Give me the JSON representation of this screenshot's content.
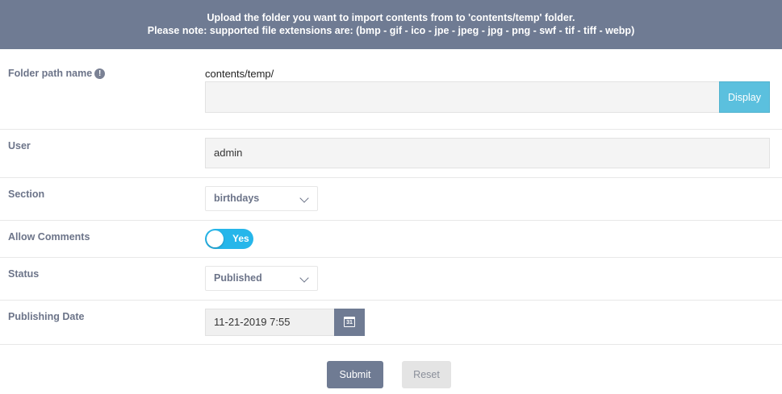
{
  "banner": {
    "line1": "Upload the folder you want to import contents from to 'contents/temp' folder.",
    "line2": "Please note: supported file extensions are: (bmp - gif - ico - jpe - jpeg - jpg - png - swf - tif - tiff - webp)"
  },
  "folder": {
    "label": "Folder path name",
    "info_icon": "!",
    "path": "contents/temp/",
    "input_value": "",
    "display_label": "Display"
  },
  "user": {
    "label": "User",
    "value": "admin"
  },
  "section": {
    "label": "Section",
    "selected": "birthdays"
  },
  "comments": {
    "label": "Allow Comments",
    "toggle_text": "Yes",
    "enabled": true
  },
  "status": {
    "label": "Status",
    "selected": "Published"
  },
  "publishing": {
    "label": "Publishing Date",
    "value": "11-21-2019 7:55",
    "calendar_icon_text": "31"
  },
  "actions": {
    "submit_label": "Submit",
    "reset_label": "Reset"
  },
  "colors": {
    "banner": "#6f7b93",
    "display_button": "#5bc0de",
    "toggle_on": "#26b6ea",
    "label_text": "#6c7489"
  }
}
